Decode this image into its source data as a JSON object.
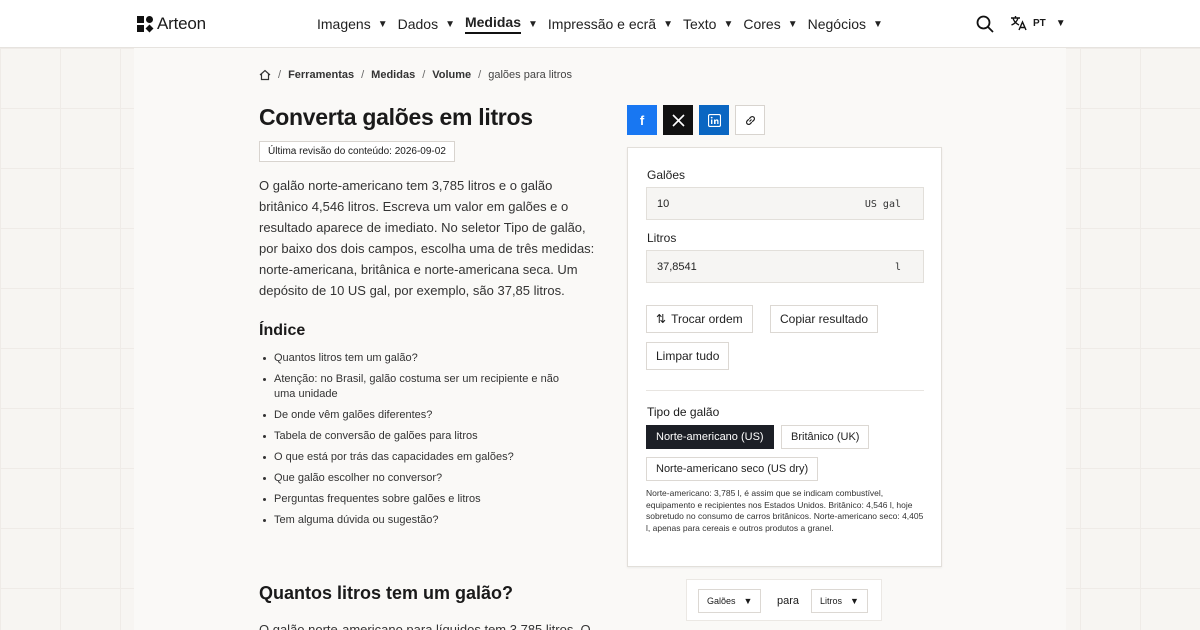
{
  "header": {
    "logo_text": "Arteon",
    "nav": [
      {
        "label": "Imagens",
        "active": false
      },
      {
        "label": "Dados",
        "active": false
      },
      {
        "label": "Medidas",
        "active": true
      },
      {
        "label": "Impressão e ecrã",
        "active": false
      },
      {
        "label": "Texto",
        "active": false
      },
      {
        "label": "Cores",
        "active": false
      },
      {
        "label": "Negócios",
        "active": false
      }
    ],
    "lang": "PT",
    "icons": {
      "search": "search-icon",
      "translate": "translate-icon",
      "caret": "▼"
    }
  },
  "breadcrumb": {
    "items": [
      "Ferramentas",
      "Medidas",
      "Volume"
    ],
    "current": "galões para litros",
    "separator": "/"
  },
  "page": {
    "title": "Converta galões em litros",
    "revision": "Última revisão do conteúdo: 2026-09-02",
    "intro": "O galão norte-americano tem 3,785 litros e o galão britânico 4,546 litros. Escreva um valor em galões e o resultado aparece de imediato. No seletor Tipo de galão, por baixo dos dois campos, escolha uma de três medidas: norte-americana, britânica e norte-americana seca. Um depósito de 10 US gal, por exemplo, são 37,85 litros.",
    "toc_title": "Índice",
    "toc": [
      "Quantos litros tem um galão?",
      "Atenção: no Brasil, galão costuma ser um recipiente e não uma unidade",
      "De onde vêm galões diferentes?",
      "Tabela de conversão de galões para litros",
      "O que está por trás das capacidades em galões?",
      "Que galão escolher no conversor?",
      "Perguntas frequentes sobre galões e litros",
      "Tem alguma dúvida ou sugestão?"
    ],
    "section_title": "Quantos litros tem um galão?",
    "section_text": "O galão norte-americano para líquidos tem 3,785 litros. O"
  },
  "share": {
    "facebook": "f",
    "x": "𝕏",
    "linkedin": "in",
    "link_icon": "link-icon"
  },
  "converter": {
    "from_label": "Galões",
    "from_value": "10",
    "from_unit": "US gal",
    "to_label": "Litros",
    "to_value": "37,8541",
    "to_unit": "l",
    "swap_label": "Trocar ordem",
    "swap_icon": "⇅",
    "copy_label": "Copiar resultado",
    "clear_label": "Limpar tudo",
    "type_label": "Tipo de galão",
    "types": [
      {
        "label": "Norte-americano (US)",
        "selected": true
      },
      {
        "label": "Britânico (UK)",
        "selected": false
      },
      {
        "label": "Norte-americano seco (US dry)",
        "selected": false
      }
    ],
    "type_note": "Norte-americano: 3,785 l, é assim que se indicam combustível, equipamento e recipientes nos Estados Unidos. Britânico: 4,546 l, hoje sobretudo no consumo de carros britânicos. Norte-americano seco: 4,405 l, apenas para cereais e outros produtos a granel."
  },
  "unit_bar": {
    "from": "Galões",
    "to_word": "para",
    "to": "Litros"
  },
  "colors": {
    "facebook": "#1877f2",
    "x": "#111111",
    "linkedin": "#0a66c2",
    "selected_type": "#1c1f26"
  }
}
